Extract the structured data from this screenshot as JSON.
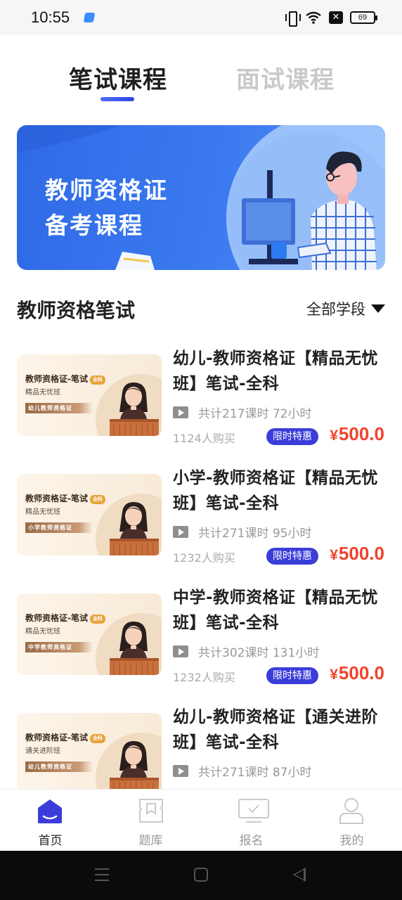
{
  "status_bar": {
    "time": "10:55",
    "battery": "69",
    "icons": [
      "vibrate-icon",
      "wifi-icon",
      "no-sim-icon",
      "battery-icon"
    ]
  },
  "tabs": [
    {
      "label": "笔试课程",
      "active": true
    },
    {
      "label": "面试课程",
      "active": false
    }
  ],
  "banner": {
    "line1": "教师资格证",
    "line2": "备考课程"
  },
  "section": {
    "title": "教师资格笔试",
    "filter_label": "全部学段"
  },
  "courses": [
    {
      "title": "幼儿-教师资格证【精品无忧班】笔试-全科",
      "meta": "共计217课时 72小时",
      "buyers": "1124人购买",
      "badge": "限时特惠",
      "price_symbol": "¥",
      "price": "500.0",
      "thumb": {
        "title": "教师资格证-笔试",
        "tag": "全科",
        "subtitle": "精品无忧班",
        "ribbon": "幼儿教师资格证"
      }
    },
    {
      "title": "小学-教师资格证【精品无忧班】笔试-全科",
      "meta": "共计271课时 95小时",
      "buyers": "1232人购买",
      "badge": "限时特惠",
      "price_symbol": "¥",
      "price": "500.0",
      "thumb": {
        "title": "教师资格证-笔试",
        "tag": "全科",
        "subtitle": "精品无忧班",
        "ribbon": "小学教师资格证"
      }
    },
    {
      "title": "中学-教师资格证【精品无忧班】笔试-全科",
      "meta": "共计302课时 131小时",
      "buyers": "1232人购买",
      "badge": "限时特惠",
      "price_symbol": "¥",
      "price": "500.0",
      "thumb": {
        "title": "教师资格证-笔试",
        "tag": "全科",
        "subtitle": "精品无忧班",
        "ribbon": "中学教师资格证"
      }
    },
    {
      "title": "幼儿-教师资格证【通关进阶班】笔试-全科",
      "meta": "共计271课时 87小时",
      "buyers": "",
      "badge": "",
      "price_symbol": "",
      "price": "",
      "thumb": {
        "title": "教师资格证-笔试",
        "tag": "全科",
        "subtitle": "通关进阶班",
        "ribbon": "幼儿教师资格证"
      }
    }
  ],
  "bottom_nav": [
    {
      "label": "首页",
      "icon": "home-icon",
      "active": true
    },
    {
      "label": "题库",
      "icon": "question-bank-icon",
      "active": false
    },
    {
      "label": "报名",
      "icon": "register-icon",
      "active": false
    },
    {
      "label": "我的",
      "icon": "profile-icon",
      "active": false
    }
  ],
  "colors": {
    "accent": "#3b3dd9",
    "price": "#f0432c",
    "banner": "#2e6ae6"
  }
}
